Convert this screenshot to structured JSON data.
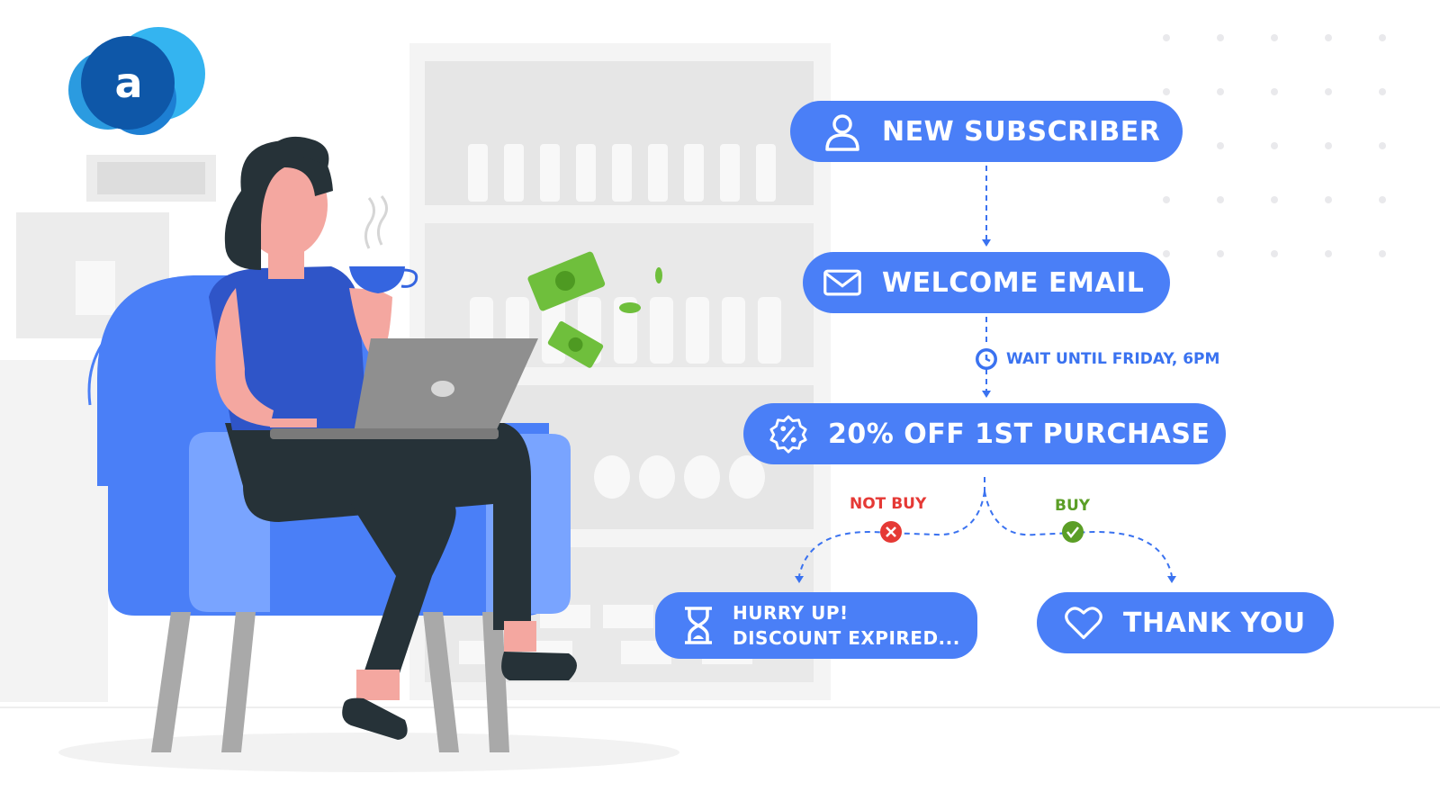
{
  "brand": {
    "logo_letter": "a"
  },
  "flow": {
    "step1": {
      "label": "NEW SUBSCRIBER",
      "icon": "user-icon"
    },
    "step2": {
      "label": "WELCOME EMAIL",
      "icon": "envelope-icon"
    },
    "wait": {
      "label": "WAIT UNTIL FRIDAY, 6PM",
      "icon": "clock-icon"
    },
    "step3": {
      "label": "20% OFF 1ST PURCHASE",
      "icon": "percent-badge-icon"
    },
    "branch_not_buy": {
      "label": "NOT BUY",
      "icon": "x-circle-icon"
    },
    "branch_buy": {
      "label": "BUY",
      "icon": "check-circle-icon"
    },
    "outcome_not_buy": {
      "line1": "HURRY UP!",
      "line2": "DISCOUNT EXPIRED...",
      "icon": "hourglass-icon"
    },
    "outcome_buy": {
      "label": "THANK YOU",
      "icon": "heart-icon"
    }
  },
  "colors": {
    "node_blue": "#4a7ff7",
    "connector": "#3a72f0",
    "not_buy_red": "#e53935",
    "buy_green": "#5b9e26"
  }
}
